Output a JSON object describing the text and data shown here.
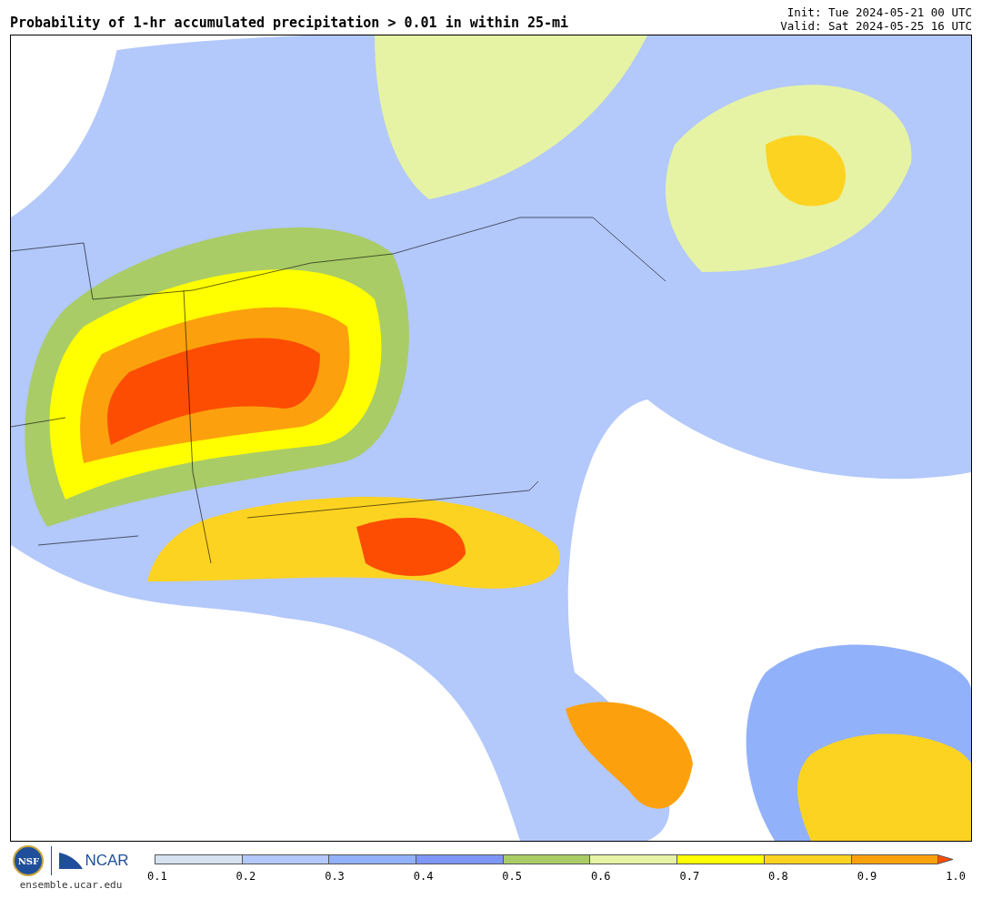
{
  "title": "Probability of 1-hr accumulated precipitation > 0.01 in within 25-mi",
  "init": "Init: Tue 2024-05-21 00 UTC",
  "valid": "Valid: Sat 2024-05-25 16 UTC",
  "logos": {
    "nsf": "NSF",
    "ncar": "NCAR",
    "url": "ensemble.ucar.edu"
  },
  "colorbar": {
    "bins": [
      {
        "color": "#d6e2ef"
      },
      {
        "color": "#b3c8fb"
      },
      {
        "color": "#92b1fb"
      },
      {
        "color": "#7e96f8"
      },
      {
        "color": "#a9cc66"
      },
      {
        "color": "#e6f3a4"
      },
      {
        "color": "#ffff00"
      },
      {
        "color": "#fdd321"
      },
      {
        "color": "#fca10d"
      },
      {
        "kind": "arrow",
        "color": "#fc4d03"
      }
    ],
    "ticks": [
      "0.1",
      "0.2",
      "0.3",
      "0.4",
      "0.5",
      "0.6",
      "0.7",
      "0.8",
      "0.9",
      "1.0"
    ]
  }
}
